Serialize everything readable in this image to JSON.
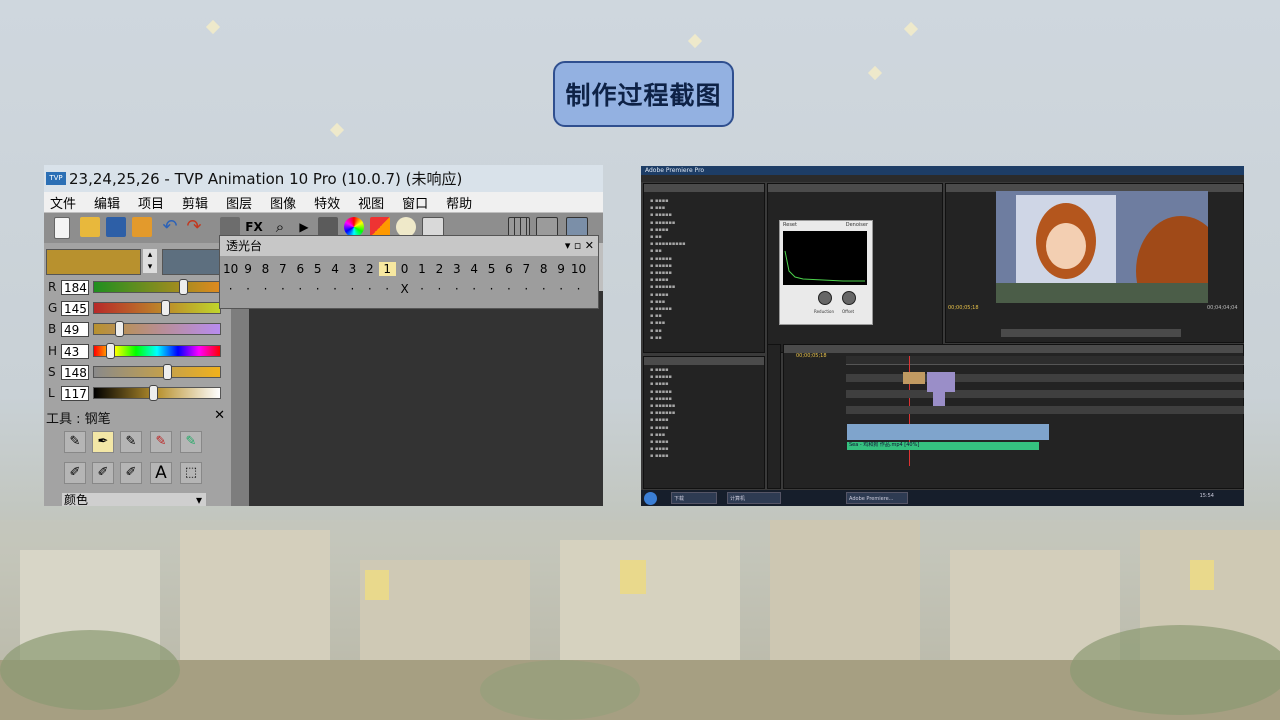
{
  "slide": {
    "title": "制作过程截图"
  },
  "tvp": {
    "window_title": "23,24,25,26 - TVP Animation 10 Pro (10.0.7) (未响应)",
    "app_icon_label": "TVP",
    "menu": [
      "文件",
      "编辑",
      "项目",
      "剪辑",
      "图层",
      "图像",
      "特效",
      "视图",
      "窗口",
      "帮助"
    ],
    "fx_label": "FX",
    "primary_color": "#b8912e",
    "channels": [
      {
        "label": "R",
        "value": "184",
        "fraction": 0.72
      },
      {
        "label": "G",
        "value": "145",
        "fraction": 0.57
      },
      {
        "label": "B",
        "value": "49",
        "fraction": 0.19
      },
      {
        "label": "H",
        "value": "43",
        "fraction": 0.12
      },
      {
        "label": "S",
        "value": "148",
        "fraction": 0.58
      },
      {
        "label": "L",
        "value": "117",
        "fraction": 0.46
      }
    ],
    "tool_panel_title": "工具 : 钢笔",
    "tool_close": "✕",
    "text_tool": "A",
    "color_dropdown": "颜色",
    "onion_skin": {
      "title": "透光台",
      "controls": "▾ ▫ ✕",
      "numbers": [
        "10",
        "9",
        "8",
        "7",
        "6",
        "5",
        "4",
        "3",
        "2",
        "1",
        "0",
        "1",
        "2",
        "3",
        "4",
        "5",
        "6",
        "7",
        "8",
        "9",
        "10"
      ],
      "current_index": 9,
      "center_mark": "X"
    }
  },
  "premiere": {
    "window_title": "Adobe Premiere Pro",
    "timecode_program": "00;00;05;18",
    "timecode_duration": "00;04;04;04",
    "timeline_timecode": "00;00;05;18",
    "effect_name": "Denoiser",
    "effect_reset": "Reset",
    "effect_labels": [
      "Reduction",
      "Offset"
    ],
    "audio_clip_label": "Sea - 鸡和狗 作品.mp4 [40%]",
    "taskbar_items": [
      "下载",
      "计算机",
      "Adobe Premiere..."
    ],
    "clock": "15:54"
  }
}
